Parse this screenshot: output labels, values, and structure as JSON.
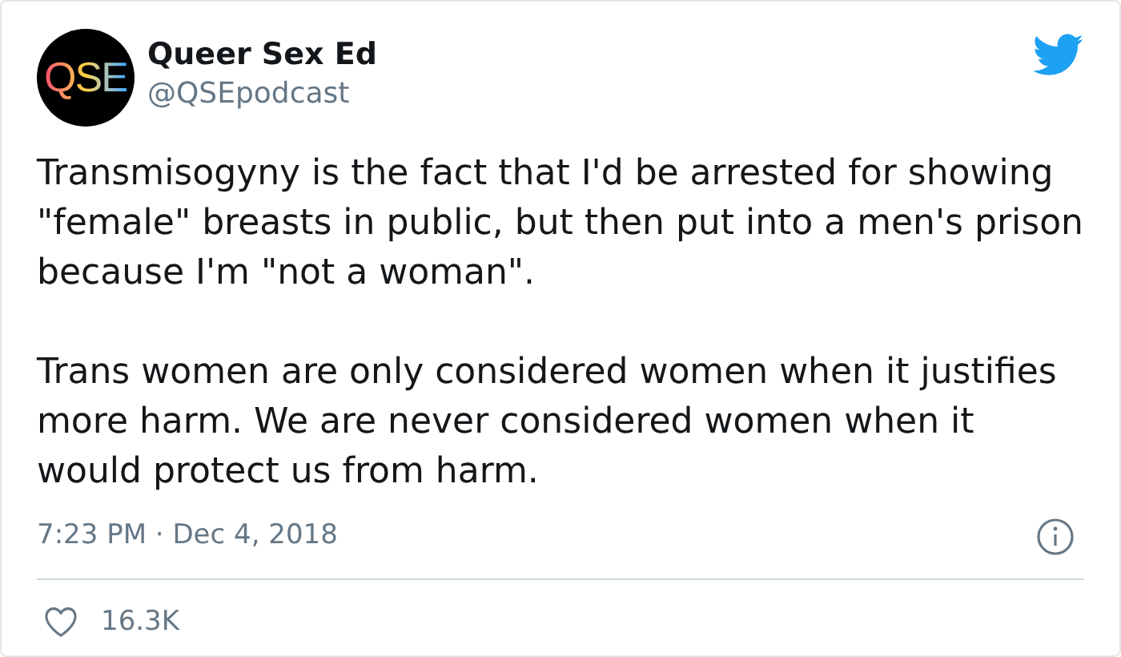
{
  "author": {
    "avatar_text": "QSE",
    "name": "Queer Sex Ed",
    "handle": "@QSEpodcast"
  },
  "paragraphs": [
    "Transmisogyny is the fact that I'd be arrested for showing \"female\" breasts in public, but then put into a men's prison because I'm \"not a woman\".",
    "Trans women are only considered women when it justifies more harm. We are never considered women when it would protect us from harm."
  ],
  "timestamp": "7:23 PM · Dec 4, 2018",
  "likes": "16.3K"
}
